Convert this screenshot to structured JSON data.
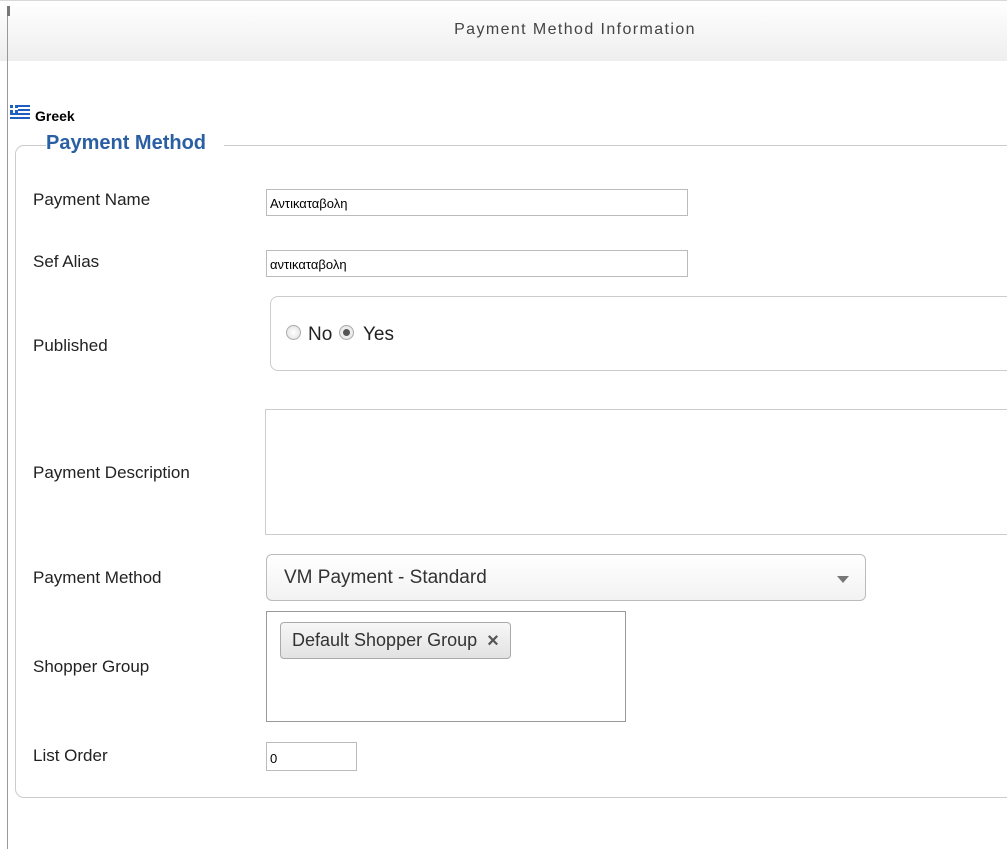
{
  "panel": {
    "title": "Payment Method Information"
  },
  "language": {
    "label": "Greek",
    "flag_icon": "greek-flag-icon"
  },
  "fieldset": {
    "legend": "Payment Method"
  },
  "fields": {
    "payment_name": {
      "label": "Payment Name",
      "value": "Αντικαταβολη"
    },
    "sef_alias": {
      "label": "Sef Alias",
      "value": "αντικαταβολη"
    },
    "published": {
      "label": "Published",
      "options": [
        {
          "label": "No",
          "selected": false
        },
        {
          "label": "Yes",
          "selected": true
        }
      ]
    },
    "payment_description": {
      "label": "Payment Description",
      "value": ""
    },
    "payment_method": {
      "label": "Payment Method",
      "value": "VM Payment - Standard"
    },
    "shopper_group": {
      "label": "Shopper Group",
      "chips": [
        {
          "label": "Default Shopper Group",
          "close": "×"
        }
      ]
    },
    "list_order": {
      "label": "List Order",
      "value": "0"
    }
  },
  "colors": {
    "legend": "#2b5fa4",
    "border": "#cccccc"
  }
}
